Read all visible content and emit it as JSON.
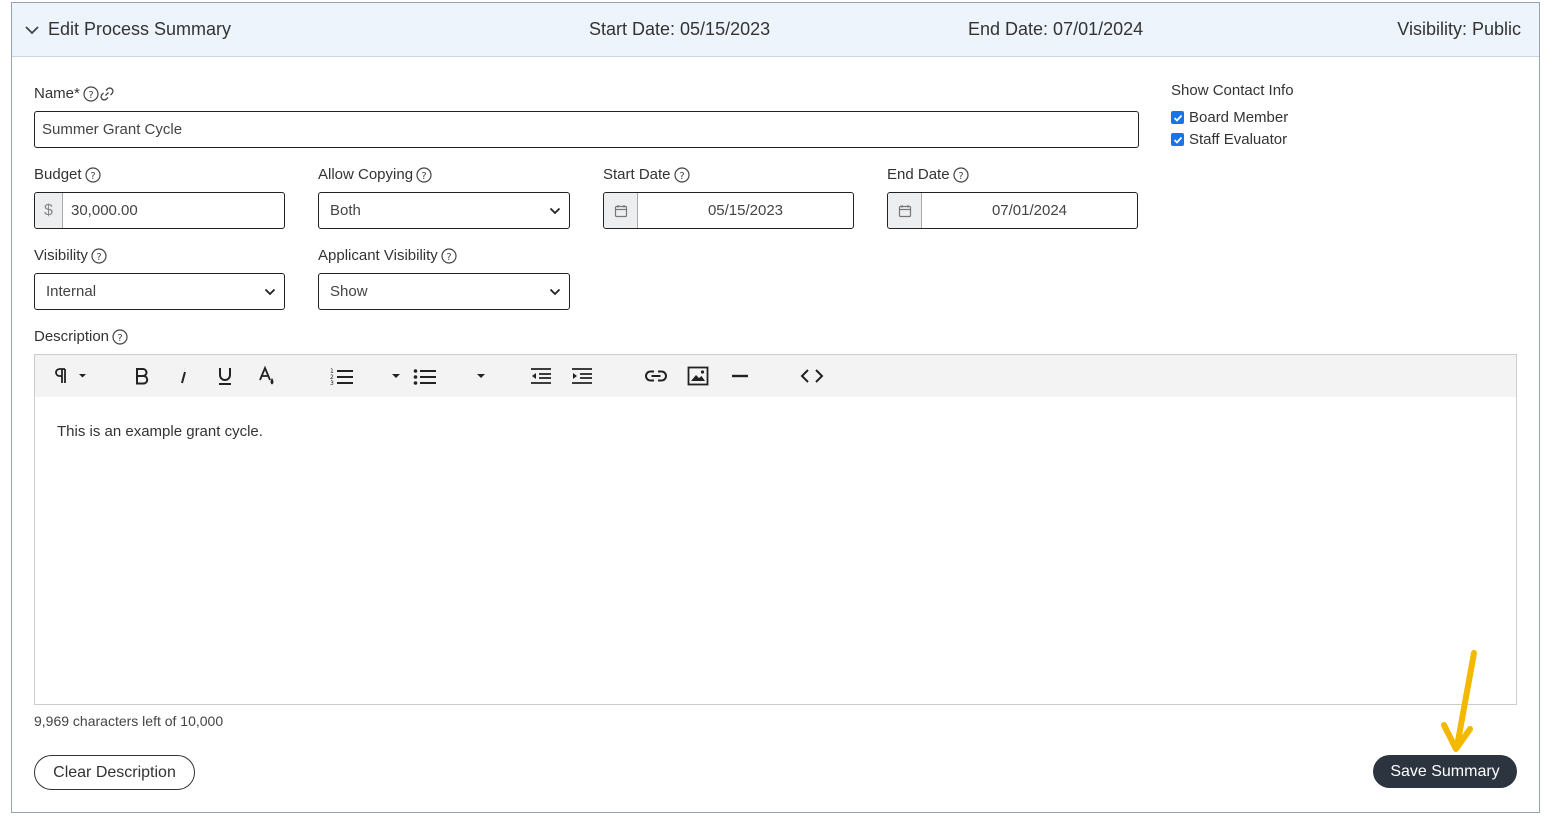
{
  "header": {
    "title": "Edit Process Summary",
    "start": "Start Date: 05/15/2023",
    "end": "End Date: 07/01/2024",
    "visibility": "Visibility: Public"
  },
  "form": {
    "name_label": "Name*",
    "name_value": "Summer Grant Cycle",
    "budget_label": "Budget",
    "budget_prefix": "$",
    "budget_value": "30,000.00",
    "allow_copying_label": "Allow Copying",
    "allow_copying_value": "Both",
    "start_date_label": "Start Date",
    "start_date_value": "05/15/2023",
    "end_date_label": "End Date",
    "end_date_value": "07/01/2024",
    "visibility_label": "Visibility",
    "visibility_value": "Internal",
    "applicant_visibility_label": "Applicant Visibility",
    "applicant_visibility_value": "Show",
    "description_label": "Description"
  },
  "contact": {
    "title": "Show Contact Info",
    "options": [
      {
        "label": "Board Member",
        "checked": true
      },
      {
        "label": "Staff Evaluator",
        "checked": true
      }
    ]
  },
  "editor": {
    "body": "This is an example grant cycle.",
    "counter": "9,969 characters left of 10,000"
  },
  "actions": {
    "clear": "Clear Description",
    "save": "Save Summary"
  },
  "colors": {
    "accent": "#1a73e8",
    "save_bg": "#2c3440",
    "annotation": "#f5b800"
  }
}
